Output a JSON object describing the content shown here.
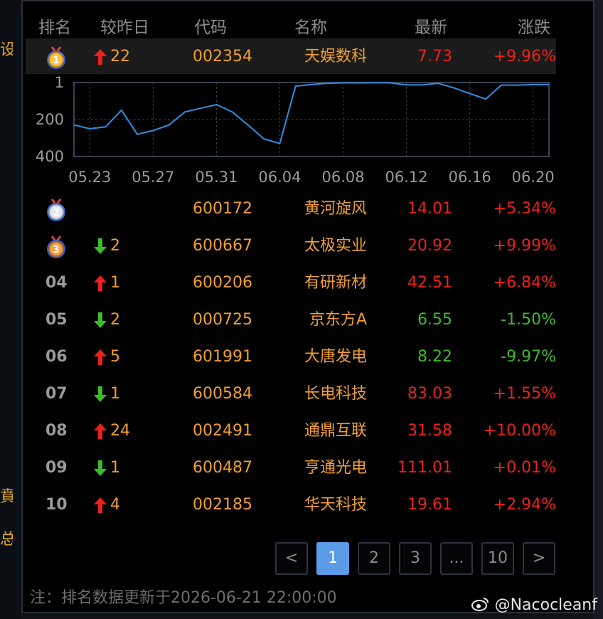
{
  "edge_chars": [
    "设",
    "賁",
    "总"
  ],
  "headers": {
    "rank": "排名",
    "vs_yesterday": "较昨日",
    "code": "代码",
    "name": "名称",
    "latest": "最新",
    "change": "涨跌"
  },
  "rows": [
    {
      "rank": "1",
      "medal": "gold",
      "dir": "up",
      "delta": "22",
      "code": "002354",
      "name": "天娱数科",
      "price": "7.73",
      "pct": "+9.96%",
      "price_color": "red",
      "pct_color": "red"
    },
    {
      "rank": "2",
      "medal": "silver",
      "dir": "",
      "delta": "",
      "code": "600172",
      "name": "黄河旋风",
      "price": "14.01",
      "pct": "+5.34%",
      "price_color": "red",
      "pct_color": "red"
    },
    {
      "rank": "3",
      "medal": "bronze",
      "dir": "down",
      "delta": "2",
      "code": "600667",
      "name": "太极实业",
      "price": "20.92",
      "pct": "+9.99%",
      "price_color": "red",
      "pct_color": "red"
    },
    {
      "rank": "04",
      "medal": "",
      "dir": "up",
      "delta": "1",
      "code": "600206",
      "name": "有研新材",
      "price": "42.51",
      "pct": "+6.84%",
      "price_color": "red",
      "pct_color": "red"
    },
    {
      "rank": "05",
      "medal": "",
      "dir": "down",
      "delta": "2",
      "code": "000725",
      "name": "京东方A",
      "price": "6.55",
      "pct": "-1.50%",
      "price_color": "green",
      "pct_color": "green"
    },
    {
      "rank": "06",
      "medal": "",
      "dir": "up",
      "delta": "5",
      "code": "601991",
      "name": "大唐发电",
      "price": "8.22",
      "pct": "-9.97%",
      "price_color": "green",
      "pct_color": "green"
    },
    {
      "rank": "07",
      "medal": "",
      "dir": "down",
      "delta": "1",
      "code": "600584",
      "name": "长电科技",
      "price": "83.03",
      "pct": "+1.55%",
      "price_color": "red",
      "pct_color": "red"
    },
    {
      "rank": "08",
      "medal": "",
      "dir": "up",
      "delta": "24",
      "code": "002491",
      "name": "通鼎互联",
      "price": "31.58",
      "pct": "+10.00%",
      "price_color": "red",
      "pct_color": "red"
    },
    {
      "rank": "09",
      "medal": "",
      "dir": "down",
      "delta": "1",
      "code": "600487",
      "name": "亨通光电",
      "price": "111.01",
      "pct": "+0.01%",
      "price_color": "red",
      "pct_color": "red"
    },
    {
      "rank": "10",
      "medal": "",
      "dir": "up",
      "delta": "4",
      "code": "002185",
      "name": "华天科技",
      "price": "19.61",
      "pct": "+2.94%",
      "price_color": "red",
      "pct_color": "red"
    }
  ],
  "chart_data": {
    "type": "line",
    "x": [
      "05.22",
      "05.23",
      "05.24",
      "05.25",
      "05.26",
      "05.27",
      "05.28",
      "05.29",
      "05.30",
      "05.31",
      "06.01",
      "06.02",
      "06.03",
      "06.04",
      "06.05",
      "06.06",
      "06.07",
      "06.08",
      "06.09",
      "06.10",
      "06.11",
      "06.12",
      "06.13",
      "06.14",
      "06.15",
      "06.16",
      "06.17",
      "06.18",
      "06.19",
      "06.20",
      "06.21"
    ],
    "series": [
      {
        "values": [
          230,
          250,
          240,
          150,
          280,
          260,
          230,
          160,
          140,
          120,
          160,
          230,
          305,
          330,
          20,
          12,
          5,
          3,
          3,
          2,
          3,
          14,
          14,
          5,
          30,
          60,
          90,
          15,
          15,
          12,
          12
        ]
      }
    ],
    "y_ticks": [
      "1",
      "200",
      "400"
    ],
    "ylim": [
      1,
      400
    ],
    "y_inverted": true,
    "x_ticks": [
      "05.23",
      "05.27",
      "05.31",
      "06.04",
      "06.08",
      "06.12",
      "06.16",
      "06.20"
    ],
    "grid": true,
    "line_color": "#2f8fe0"
  },
  "pagination": {
    "prev": "<",
    "pages": [
      "1",
      "2",
      "3",
      "...",
      "10"
    ],
    "active": "1",
    "next": ">"
  },
  "note": "注：排名数据更新于2026-06-21 22:00:00",
  "watermark": "@Nacocleanf",
  "colors": {
    "red": "#e8231b",
    "green": "#3dbb2c",
    "orange": "#f0a030",
    "accent": "#5c9be6"
  }
}
